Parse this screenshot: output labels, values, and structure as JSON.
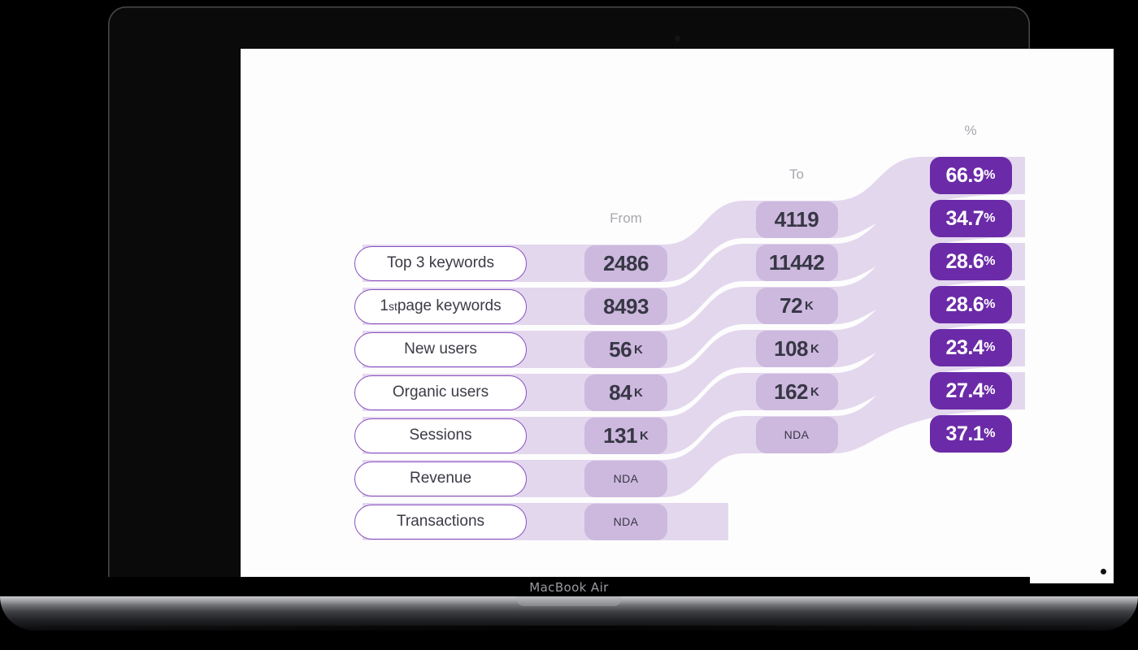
{
  "device": {
    "brand_label": "MacBook Air",
    "camera_icon": "camera-dot-icon"
  },
  "chart_data": {
    "type": "funnel",
    "title": "",
    "columns": [
      "From",
      "To",
      "%"
    ],
    "headers": {
      "from": "From",
      "to": "To",
      "percent": "%"
    },
    "colors": {
      "ribbon": "#e3d7ee",
      "value_pill": "#cdb8de",
      "percent_pill": "#6b2ba8",
      "label_border": "#8b4fbf",
      "label_text": "#3b3b46",
      "header_text": "#a7a7ae",
      "background": "#fdfdfd"
    },
    "rows": [
      {
        "label": "Top 3 keywords",
        "label_prefix": "",
        "label_ordinal": "",
        "label_rest": "Top 3 keywords",
        "from": "2486",
        "from_unit": "",
        "to": "4119",
        "to_unit": "",
        "percent": "66.9",
        "percent_symbol": "%"
      },
      {
        "label": "1st page keywords",
        "label_prefix": "1",
        "label_ordinal": "st",
        "label_rest": " page keywords",
        "from": "8493",
        "from_unit": "",
        "to": "11442",
        "to_unit": "",
        "percent": "34.7",
        "percent_symbol": "%"
      },
      {
        "label": "New users",
        "label_prefix": "",
        "label_ordinal": "",
        "label_rest": "New users",
        "from": "56",
        "from_unit": "K",
        "to": "72",
        "to_unit": "K",
        "percent": "28.6",
        "percent_symbol": "%"
      },
      {
        "label": "Organic users",
        "label_prefix": "",
        "label_ordinal": "",
        "label_rest": "Organic users",
        "from": "84",
        "from_unit": "K",
        "to": "108",
        "to_unit": "K",
        "percent": "28.6",
        "percent_symbol": "%"
      },
      {
        "label": "Sessions",
        "label_prefix": "",
        "label_ordinal": "",
        "label_rest": "Sessions",
        "from": "131",
        "from_unit": "K",
        "to": "162",
        "to_unit": "K",
        "percent": "23.4",
        "percent_symbol": "%"
      },
      {
        "label": "Revenue",
        "label_prefix": "",
        "label_ordinal": "",
        "label_rest": "Revenue",
        "from": "NDA",
        "from_unit": "",
        "to": "NDA",
        "to_unit": "",
        "percent": "27.4",
        "percent_symbol": "%"
      },
      {
        "label": "Transactions",
        "label_prefix": "",
        "label_ordinal": "",
        "label_rest": "Transactions",
        "from": "NDA",
        "from_unit": "",
        "to": "",
        "to_unit": "",
        "percent": "37.1",
        "percent_symbol": "%"
      }
    ]
  }
}
